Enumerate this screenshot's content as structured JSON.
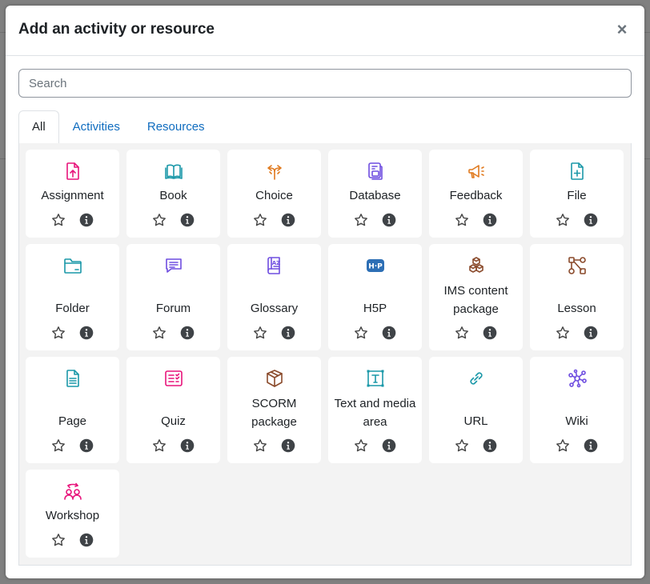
{
  "modal": {
    "title": "Add an activity or resource",
    "close_label": "×"
  },
  "search": {
    "placeholder": "Search",
    "value": ""
  },
  "tabs": [
    {
      "label": "All",
      "active": true
    },
    {
      "label": "Activities",
      "active": false
    },
    {
      "label": "Resources",
      "active": false
    }
  ],
  "colors": {
    "pink": "#e8147b",
    "teal": "#1a98a8",
    "orange": "#e07a1f",
    "purple": "#6f4ee0",
    "blue": "#2d6fb5",
    "brown": "#8a4a2b",
    "link": "#0f6cbf"
  },
  "items": [
    {
      "label": "Assignment",
      "icon": "assignment-icon",
      "color": "#e8147b"
    },
    {
      "label": "Book",
      "icon": "book-icon",
      "color": "#1a98a8"
    },
    {
      "label": "Choice",
      "icon": "choice-icon",
      "color": "#e07a1f"
    },
    {
      "label": "Database",
      "icon": "database-icon",
      "color": "#6f4ee0"
    },
    {
      "label": "Feedback",
      "icon": "feedback-icon",
      "color": "#e07a1f"
    },
    {
      "label": "File",
      "icon": "file-icon",
      "color": "#1a98a8"
    },
    {
      "label": "Folder",
      "icon": "folder-icon",
      "color": "#1a98a8"
    },
    {
      "label": "Forum",
      "icon": "forum-icon",
      "color": "#6f4ee0"
    },
    {
      "label": "Glossary",
      "icon": "glossary-icon",
      "color": "#6f4ee0"
    },
    {
      "label": "H5P",
      "icon": "h5p-icon",
      "color": "#2d6fb5"
    },
    {
      "label": "IMS content package",
      "icon": "ims-package-icon",
      "color": "#8a4a2b"
    },
    {
      "label": "Lesson",
      "icon": "lesson-icon",
      "color": "#8a4a2b"
    },
    {
      "label": "Page",
      "icon": "page-icon",
      "color": "#1a98a8"
    },
    {
      "label": "Quiz",
      "icon": "quiz-icon",
      "color": "#e8147b"
    },
    {
      "label": "SCORM package",
      "icon": "scorm-icon",
      "color": "#8a4a2b"
    },
    {
      "label": "Text and media area",
      "icon": "text-media-icon",
      "color": "#1a98a8"
    },
    {
      "label": "URL",
      "icon": "url-link-icon",
      "color": "#1a98a8"
    },
    {
      "label": "Wiki",
      "icon": "wiki-icon",
      "color": "#6f4ee0"
    },
    {
      "label": "Workshop",
      "icon": "workshop-icon",
      "color": "#e8147b"
    }
  ]
}
